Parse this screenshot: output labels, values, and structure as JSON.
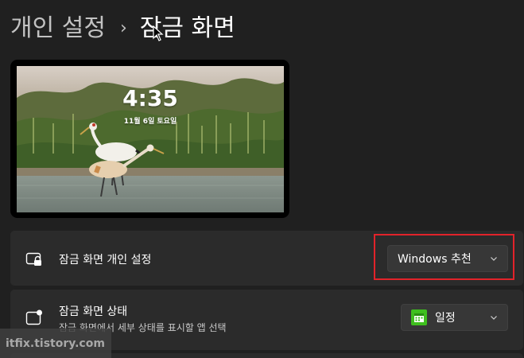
{
  "header": {
    "parent": "개인 설정",
    "separator": "›",
    "current": "잠금 화면"
  },
  "preview": {
    "time": "4:35",
    "date": "11월 6일 토요일"
  },
  "settings": [
    {
      "icon": "lock-screen-icon",
      "title": "잠금 화면 개인 설정",
      "dropdown_value": "Windows 추천"
    },
    {
      "icon": "lock-screen-status-icon",
      "title": "잠금 화면 상태",
      "description": "잠금 화면에서 세부 상태를 표시할 앱 선택",
      "dropdown_value": "일정",
      "dropdown_icon": "calendar-app-icon"
    }
  ],
  "watermark": "itfix.tistory.com",
  "colors": {
    "background": "#202020",
    "card": "#2b2b2b",
    "dropdown": "#373737",
    "highlight": "#e2232a",
    "calendar_app": "#3fbf1e"
  }
}
